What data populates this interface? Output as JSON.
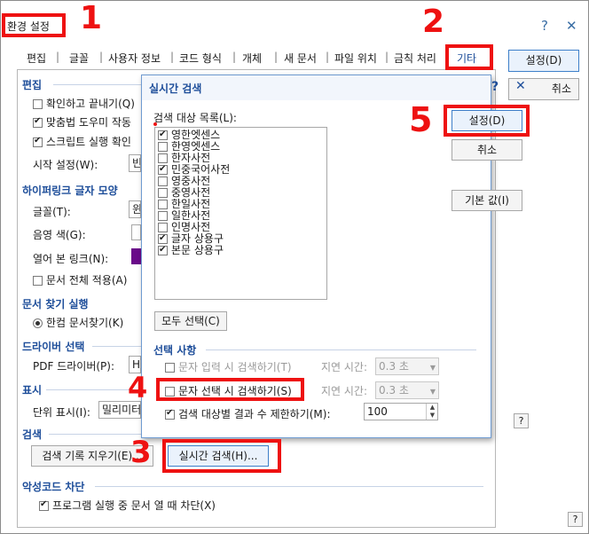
{
  "window": {
    "title": "환경 설정",
    "help": "?",
    "close": "✕"
  },
  "tabs": [
    "편집",
    "글꼴",
    "사용자 정보",
    "코드 형식",
    "개체",
    "새 문서",
    "파일 위치",
    "금칙 처리",
    "기타"
  ],
  "main_buttons": {
    "set": "설정(D)",
    "cancel": "취소"
  },
  "sections": {
    "edit": {
      "title": "편집",
      "confirm_close": "확인하고 끝내기(Q)",
      "spell_check": "맞춤법 도우미 작동",
      "script_run": "스크립트 실행 확인",
      "start_setting_label": "시작 설정(W):",
      "start_setting_value": "빈"
    },
    "hyperlink": {
      "title": "하이퍼링크 글자 모양",
      "font_label": "글꼴(T):",
      "font_value": "윈",
      "shade_label": "음영 색(G):",
      "visited_label": "열어 본 링크(N):",
      "apply_all": "문서 전체 적용(A)"
    },
    "find": {
      "title": "문서 찾기 실행",
      "hancom": "한컴 문서찾기(K)"
    },
    "driver": {
      "title": "드라이버 선택",
      "pdf_label": "PDF 드라이버(P):",
      "pdf_value": "H"
    },
    "display": {
      "title": "표시",
      "unit_label": "단위 표시(I):",
      "unit_value": "밀리미터"
    },
    "search": {
      "title": "검색",
      "clear_history": "검색 기록 지우기(E)...",
      "realtime": "실시간 검색(H)..."
    },
    "malware": {
      "title": "악성코드 차단",
      "block": "프로그램 실행 중 문서 열 때 차단(X)"
    }
  },
  "dialog": {
    "title": "실시간 검색",
    "help": "?",
    "close": "✕",
    "list_label": "검색 대상 목록(L):",
    "items": [
      {
        "label": "영한엣센스",
        "checked": true
      },
      {
        "label": "한영엣센스",
        "checked": false
      },
      {
        "label": "한자사전",
        "checked": false
      },
      {
        "label": "민중국어사전",
        "checked": true
      },
      {
        "label": "영중사전",
        "checked": false
      },
      {
        "label": "중영사전",
        "checked": false
      },
      {
        "label": "한일사전",
        "checked": false
      },
      {
        "label": "일한사전",
        "checked": false
      },
      {
        "label": "인명사전",
        "checked": false
      },
      {
        "label": "글자 상용구",
        "checked": true
      },
      {
        "label": "본문 상용구",
        "checked": true
      }
    ],
    "select_all": "모두 선택(C)",
    "options_title": "선택 사항",
    "opt_input": "문자 입력 시 검색하기(T)",
    "opt_select": "문자 선택 시 검색하기(S)",
    "delay_label": "지연 시간:",
    "delay_value": "0.3 초",
    "limit_label": "검색 대상별 결과 수 제한하기(M):",
    "limit_value": "100",
    "btn_set": "설정(D)",
    "btn_cancel": "취소",
    "btn_default": "기본 값(I)",
    "help_btn": "?"
  },
  "annotations": [
    "1",
    "2",
    "3",
    "4",
    "5"
  ],
  "footer_help": "?",
  "colors": {
    "annotation": "#ee1111",
    "section_title": "#1e4e9a",
    "visited_link": "#6a0a8a"
  }
}
